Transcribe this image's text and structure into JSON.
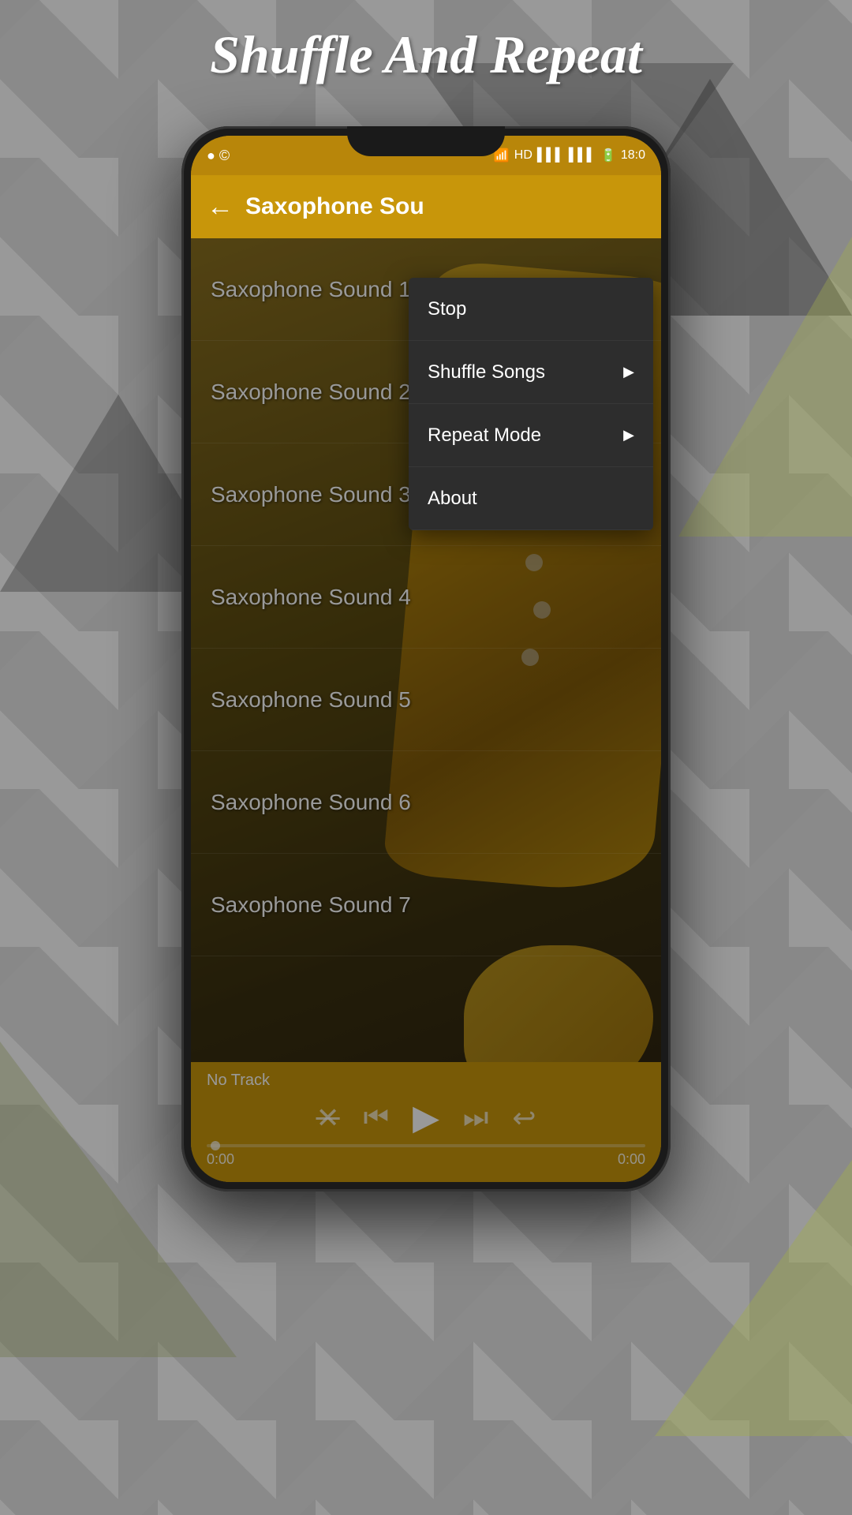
{
  "page": {
    "title": "Shuffle And Repeat"
  },
  "status_bar": {
    "time": "18:0",
    "left_icon": "●",
    "wifi": "WiFi",
    "hd": "HD",
    "signal1": "▌▌▌",
    "signal2": "▌▌▌",
    "battery": "▬"
  },
  "header": {
    "title": "Saxophone Sou",
    "back_icon": "←"
  },
  "songs": [
    {
      "id": 1,
      "label": "Saxophone Sound 1"
    },
    {
      "id": 2,
      "label": "Saxophone Sound 2"
    },
    {
      "id": 3,
      "label": "Saxophone Sound 3"
    },
    {
      "id": 4,
      "label": "Saxophone Sound 4"
    },
    {
      "id": 5,
      "label": "Saxophone Sound 5"
    },
    {
      "id": 6,
      "label": "Saxophone Sound 6"
    },
    {
      "id": 7,
      "label": "Saxophone Sound 7"
    }
  ],
  "player": {
    "track": "No Track",
    "time_start": "0:00",
    "time_end": "0:00"
  },
  "context_menu": {
    "items": [
      {
        "id": "stop",
        "label": "Stop",
        "has_arrow": false
      },
      {
        "id": "shuffle",
        "label": "Shuffle Songs",
        "has_arrow": true
      },
      {
        "id": "repeat",
        "label": "Repeat Mode",
        "has_arrow": true
      },
      {
        "id": "about",
        "label": "About",
        "has_arrow": false
      }
    ]
  },
  "controls": {
    "shuffle_icon": "✕",
    "prev_icon": "⏮",
    "play_icon": "▶",
    "next_icon": "⏭",
    "repeat_icon": "↩"
  }
}
